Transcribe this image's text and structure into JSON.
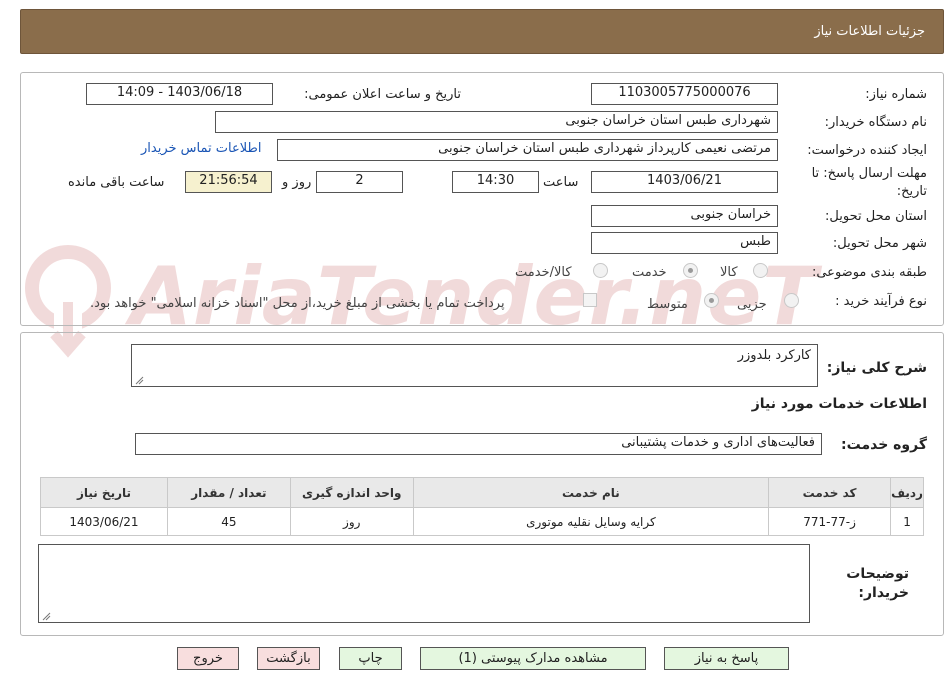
{
  "header": {
    "title": "جزئیات اطلاعات نیاز"
  },
  "watermark": {
    "text": "AriaTender.neT"
  },
  "form": {
    "need_number_label": "شماره نیاز:",
    "need_number": "1103005775000076",
    "announce_label": "تاریخ و ساعت اعلان عمومی:",
    "announce_value": "1403/06/18 - 14:09",
    "buyer_label": "نام دستگاه خریدار:",
    "buyer_value": "شهرداری طبس استان خراسان جنوبی",
    "creator_label": "ایجاد کننده درخواست:",
    "creator_value": "مرتضی نعیمی کارپرداز شهرداری طبس استان خراسان جنوبی",
    "contact_link": "اطلاعات تماس خریدار",
    "deadline_label_1": "مهلت ارسال پاسخ: تا",
    "deadline_label_2": "تاریخ:",
    "deadline_date": "1403/06/21",
    "time_label": "ساعت",
    "deadline_time": "14:30",
    "days_value": "2",
    "days_label": "روز و",
    "remaining_value": "21:56:54",
    "remaining_label": "ساعت باقی مانده",
    "province_label": "استان محل تحویل:",
    "province_value": "خراسان جنوبی",
    "city_label": "شهر محل تحویل:",
    "city_value": "طبس",
    "category_label": "طبقه بندی موضوعی:",
    "category_options": [
      "کالا",
      "خدمت",
      "کالا/خدمت"
    ],
    "category_selected": "خدمت",
    "process_label": "نوع فرآیند خرید :",
    "process_options": [
      "جزیی",
      "متوسط"
    ],
    "process_selected": "متوسط",
    "payment_note": "پرداخت تمام یا بخشی از مبلغ خرید،از محل \"اسناد خزانه اسلامی\" خواهد بود."
  },
  "details": {
    "description_label": "شرح کلی نیاز:",
    "description_value": "کارکرد بلدوزر",
    "services_heading": "اطلاعات خدمات مورد نیاز",
    "service_group_label": "گروه خدمت:",
    "service_group_value": "فعالیت‌های اداری و خدمات پشتیبانی",
    "table": {
      "headers": [
        "ردیف",
        "کد خدمت",
        "نام خدمت",
        "واحد اندازه گیری",
        "تعداد / مقدار",
        "تاریخ نیاز"
      ],
      "rows": [
        [
          "1",
          "ز-77-771",
          "کرایه وسایل نقلیه موتوری",
          "روز",
          "45",
          "1403/06/21"
        ]
      ]
    },
    "buyer_notes_label_1": "توضیحات",
    "buyer_notes_label_2": "خریدار:",
    "buyer_notes_value": ""
  },
  "buttons": {
    "reply": "پاسخ به نیاز",
    "attachments": "مشاهده مدارک پیوستی (1)",
    "print": "چاپ",
    "back": "بازگشت",
    "exit": "خروج"
  },
  "colors": {
    "header_bg": "#8a6d4b",
    "link": "#1a55b5",
    "green_button": "#e4f7df",
    "pink_button": "#f8dede",
    "remaining_bg": "#f6f1cf"
  }
}
